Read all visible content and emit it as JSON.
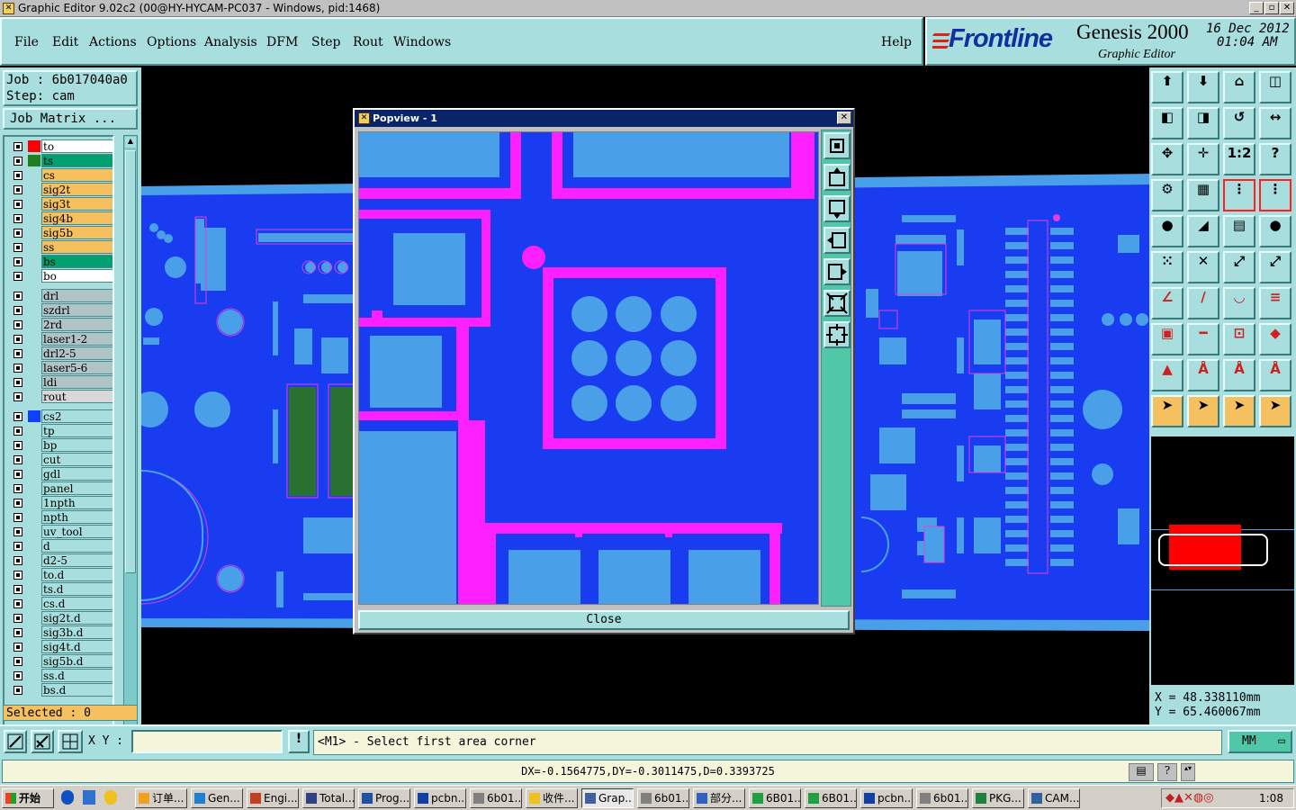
{
  "window": {
    "title": "Graphic Editor 9.02c2 (00@HY-HYCAM-PC037 - Windows, pid:1468)",
    "icon": "graphic-editor-icon"
  },
  "menu": {
    "items": [
      "File",
      "Edit",
      "Actions",
      "Options",
      "Analysis",
      "DFM",
      "Step",
      "Rout",
      "Windows"
    ],
    "help": "Help"
  },
  "brand": {
    "logo": "Frontline",
    "product": "Genesis 2000",
    "subtitle": "Graphic Editor",
    "date": "16 Dec 2012",
    "time": "01:04 AM"
  },
  "job": {
    "job_label": "Job : 6b017040a0",
    "step_label": "Step: cam",
    "matrix_button": "Job Matrix ..."
  },
  "layers": [
    {
      "name": "to",
      "bg": "#ffffff",
      "sw": "#ff0000"
    },
    {
      "name": "ts",
      "bg": "#00a070",
      "sw": "#208020",
      "selected": true
    },
    {
      "name": "cs",
      "bg": "#f5c060",
      "sw": ""
    },
    {
      "name": "sig2t",
      "bg": "#f5c060",
      "sw": ""
    },
    {
      "name": "sig3t",
      "bg": "#f5c060",
      "sw": ""
    },
    {
      "name": "sig4b",
      "bg": "#f5c060",
      "sw": ""
    },
    {
      "name": "sig5b",
      "bg": "#f5c060",
      "sw": ""
    },
    {
      "name": "ss",
      "bg": "#f5c060",
      "sw": ""
    },
    {
      "name": "bs",
      "bg": "#00a070",
      "sw": ""
    },
    {
      "name": "bo",
      "bg": "#ffffff",
      "sw": ""
    },
    {
      "name": "drl",
      "bg": "#b0c4c8",
      "sw": ""
    },
    {
      "name": "szdrl",
      "bg": "#b0c4c8",
      "sw": ""
    },
    {
      "name": "2rd",
      "bg": "#b0c4c8",
      "sw": ""
    },
    {
      "name": "laser1-2",
      "bg": "#b0c4c8",
      "sw": ""
    },
    {
      "name": "drl2-5",
      "bg": "#b0c4c8",
      "sw": ""
    },
    {
      "name": "laser5-6",
      "bg": "#b0c4c8",
      "sw": ""
    },
    {
      "name": "ldi",
      "bg": "#b0c4c8",
      "sw": ""
    },
    {
      "name": "rout",
      "bg": "#d8d8d8",
      "sw": ""
    },
    {
      "name": "cs2",
      "bg": "#a8dede",
      "sw": "#1040ff"
    },
    {
      "name": "tp",
      "bg": "#a8dede",
      "sw": ""
    },
    {
      "name": "bp",
      "bg": "#a8dede",
      "sw": ""
    },
    {
      "name": "cut",
      "bg": "#a8dede",
      "sw": ""
    },
    {
      "name": "gdl",
      "bg": "#a8dede",
      "sw": ""
    },
    {
      "name": "panel",
      "bg": "#a8dede",
      "sw": ""
    },
    {
      "name": "1npth",
      "bg": "#a8dede",
      "sw": ""
    },
    {
      "name": "npth",
      "bg": "#a8dede",
      "sw": ""
    },
    {
      "name": "uv_tool",
      "bg": "#a8dede",
      "sw": ""
    },
    {
      "name": "d",
      "bg": "#a8dede",
      "sw": ""
    },
    {
      "name": "d2-5",
      "bg": "#a8dede",
      "sw": ""
    },
    {
      "name": "to.d",
      "bg": "#a8dede",
      "sw": ""
    },
    {
      "name": "ts.d",
      "bg": "#a8dede",
      "sw": ""
    },
    {
      "name": "cs.d",
      "bg": "#a8dede",
      "sw": ""
    },
    {
      "name": "sig2t.d",
      "bg": "#a8dede",
      "sw": ""
    },
    {
      "name": "sig3b.d",
      "bg": "#a8dede",
      "sw": ""
    },
    {
      "name": "sig4t.d",
      "bg": "#a8dede",
      "sw": ""
    },
    {
      "name": "sig5b.d",
      "bg": "#a8dede",
      "sw": ""
    },
    {
      "name": "ss.d",
      "bg": "#a8dede",
      "sw": ""
    },
    {
      "name": "bs.d",
      "bg": "#a8dede",
      "sw": ""
    }
  ],
  "selected_label": "Selected : 0",
  "popview": {
    "title": "Popview - 1",
    "close_button": "Close"
  },
  "coords": {
    "x": "X = 48.338110mm",
    "y": "Y = 65.460067mm"
  },
  "status": {
    "xy_label": "X Y :",
    "xy_value": "",
    "message": "<M1> - Select first area corner",
    "units": "MM"
  },
  "dx_readout": "DX=-0.1564775,DY=-0.3011475,D=0.3393725",
  "taskbar": {
    "start": "开始",
    "tasks": [
      "订单...",
      "Gen...",
      "Engi...",
      "Total...",
      "Prog...",
      "pcbn...",
      "6b01...",
      "收件...",
      "Grap...",
      "6b01...",
      "部分...",
      "6B01...",
      "6B01...",
      "pcbn...",
      "6b01...",
      "PKG...",
      "CAM..."
    ],
    "clock": "1:08"
  }
}
